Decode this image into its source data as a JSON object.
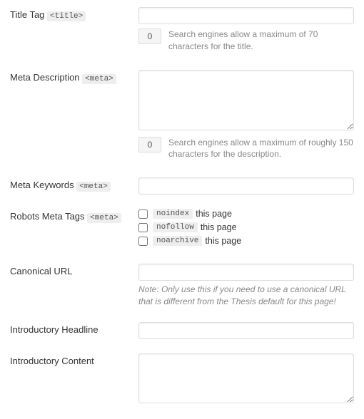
{
  "title": {
    "label": "Title Tag",
    "tag": "<title>",
    "value": "",
    "count": "0",
    "hint": "Search engines allow a maximum of 70 characters for the title."
  },
  "meta_desc": {
    "label": "Meta Description",
    "tag": "<meta>",
    "value": "",
    "count": "0",
    "hint": "Search engines allow a maximum of roughly 150 characters for the description."
  },
  "meta_keywords": {
    "label": "Meta Keywords",
    "tag": "<meta>",
    "value": ""
  },
  "robots": {
    "label": "Robots Meta Tags",
    "tag": "<meta>",
    "opts": [
      {
        "code": "noindex",
        "suffix": " this page"
      },
      {
        "code": "nofollow",
        "suffix": " this page"
      },
      {
        "code": "noarchive",
        "suffix": " this page"
      }
    ]
  },
  "canonical": {
    "label": "Canonical URL",
    "value": "",
    "note": "Note: Only use this if you need to use a canonical URL that is different from the Thesis default for this page!"
  },
  "intro_headline": {
    "label": "Introductory Headline",
    "value": ""
  },
  "intro_content": {
    "label": "Introductory Content",
    "value": ""
  }
}
